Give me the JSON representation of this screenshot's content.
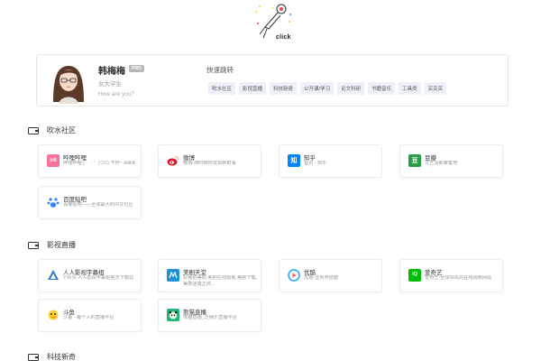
{
  "logo": {
    "text": "click"
  },
  "profile": {
    "name": "韩梅梅",
    "badge": "PRO",
    "role": "女大学生",
    "quote": "How are you？"
  },
  "quick_jump": {
    "title": "快速跳转",
    "tags": [
      "吹水社区",
      "影视直播",
      "科技新奇",
      "公开课/学习",
      "论文科研",
      "书籍音乐",
      "工具类",
      "买买买"
    ]
  },
  "sections": [
    {
      "title": "吹水社区",
      "cards": [
        {
          "name": "哔哩哔哩",
          "desc": "哔哩哔哩 ( ゜- ゜)つロ 干杯~-bilibili",
          "icon": "bilibili-icon",
          "color": "#fb7299",
          "glyph": "bili"
        },
        {
          "name": "微博",
          "desc": "微博-随时随地发现新鲜事",
          "icon": "weibo-icon",
          "color": "#e6162d",
          "glyph": ""
        },
        {
          "name": "知乎",
          "desc": "首页 - 知乎",
          "icon": "zhihu-icon",
          "color": "#0084ff",
          "glyph": "知"
        },
        {
          "name": "豆瓣",
          "desc": "文艺清新聚集地",
          "icon": "douban-icon",
          "color": "#2a9d45",
          "glyph": "豆"
        },
        {
          "name": "百度贴吧",
          "desc": "百度贴吧——全球最大的中文社区",
          "icon": "tieba-icon",
          "color": "#3385ff",
          "glyph": ""
        }
      ]
    },
    {
      "title": "影视直播",
      "cards": [
        {
          "name": "人人影视字幕组",
          "desc": "YYeTs 人人影视字幕组官方下载站",
          "icon": "yyets-icon",
          "color": "#2d7ad6",
          "glyph": ""
        },
        {
          "name": "美剧天堂",
          "desc": "好看的美剧,美剧在线观看,美剧下载,美剧迷真正的...",
          "icon": "meijutt-icon",
          "color": "#1e90d6",
          "glyph": ""
        },
        {
          "name": "优酷",
          "desc": "优酷-这世界很酷",
          "icon": "youku-icon",
          "color": "#1ea7ff",
          "glyph": ""
        },
        {
          "name": "爱奇艺",
          "desc": "爱奇艺-全球领先的在线视频网站",
          "icon": "iqiyi-icon",
          "color": "#00be06",
          "glyph": "iQ"
        },
        {
          "name": "斗鱼",
          "desc": "斗鱼 - 每个人的直播平台",
          "icon": "douyu-icon",
          "color": "#ff7700",
          "glyph": ""
        },
        {
          "name": "熊猫直播",
          "desc": "熊猫直播_泛娱乐直播平台",
          "icon": "panda-icon",
          "color": "#22b573",
          "glyph": ""
        }
      ]
    },
    {
      "title": "科技新奇",
      "cards": []
    }
  ],
  "colors": {
    "tag_bg": "#eef0f7",
    "border": "#ececec",
    "accent": "#0084ff"
  }
}
